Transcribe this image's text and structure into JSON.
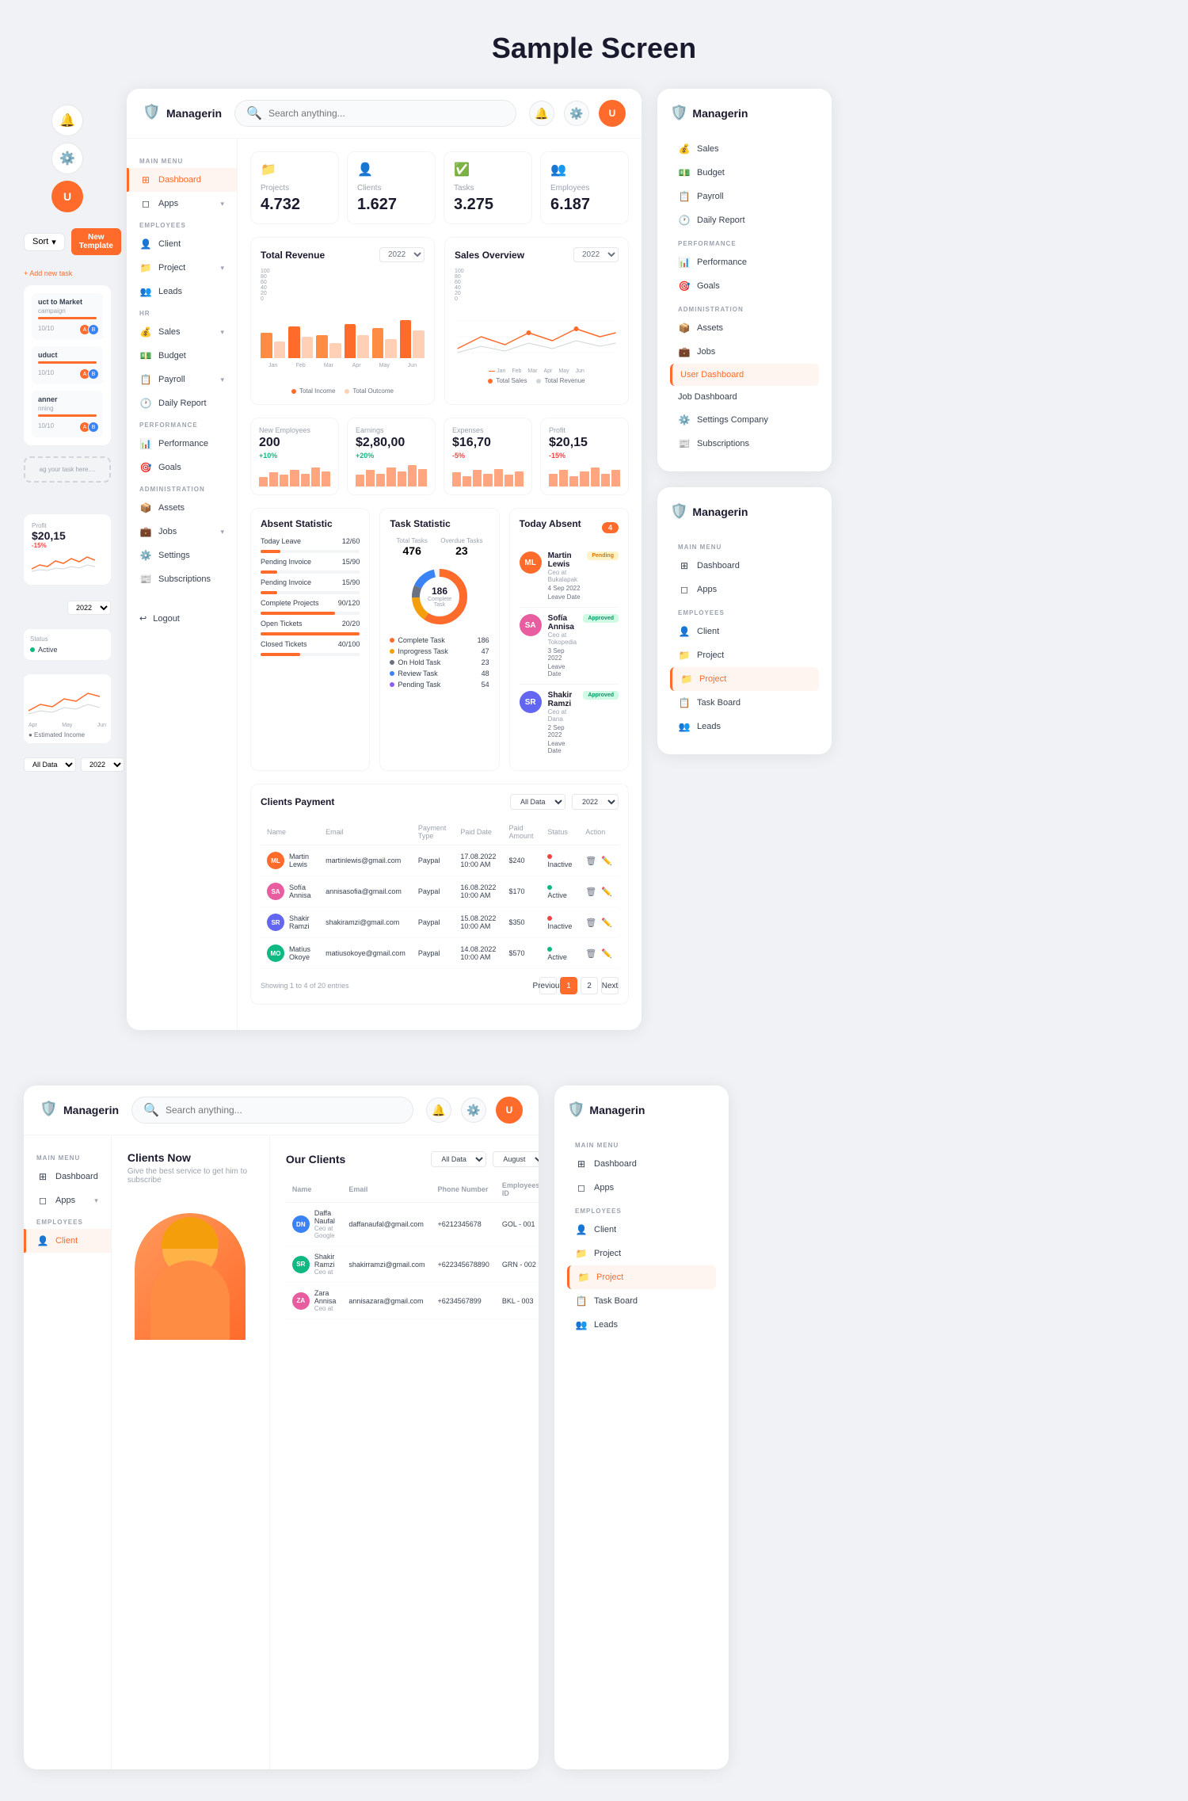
{
  "page": {
    "title": "Sample Screen"
  },
  "logo": {
    "name": "Managerin",
    "icon": "🛡️"
  },
  "header": {
    "search_placeholder": "Search anything...",
    "notification_icon": "🔔",
    "settings_icon": "⚙️"
  },
  "sidebar": {
    "main_menu_label": "MAIN MENU",
    "items": [
      {
        "id": "dashboard",
        "label": "Dashboard",
        "icon": "⊞",
        "active": true
      },
      {
        "id": "apps",
        "label": "Apps",
        "icon": "◻",
        "has_chevron": true
      }
    ],
    "employees_label": "EMPLOYEES",
    "employee_items": [
      {
        "id": "client",
        "label": "Client",
        "icon": "👤"
      },
      {
        "id": "project",
        "label": "Project",
        "icon": "📁",
        "has_chevron": true
      },
      {
        "id": "leads",
        "label": "Leads",
        "icon": "👥"
      }
    ],
    "hr_label": "HR",
    "hr_items": [
      {
        "id": "sales",
        "label": "Sales",
        "icon": "💰",
        "has_chevron": true
      },
      {
        "id": "budget",
        "label": "Budget",
        "icon": "💵"
      },
      {
        "id": "payroll",
        "label": "Payroll",
        "icon": "📋",
        "has_chevron": true
      },
      {
        "id": "daily_report",
        "label": "Daily Report",
        "icon": "🕐"
      }
    ],
    "performance_label": "PERFORMANCE",
    "performance_items": [
      {
        "id": "performance",
        "label": "Performance",
        "icon": "📊"
      },
      {
        "id": "goals",
        "label": "Goals",
        "icon": "🎯"
      }
    ],
    "administration_label": "ADMINISTRATION",
    "admin_items": [
      {
        "id": "assets",
        "label": "Assets",
        "icon": "📦"
      },
      {
        "id": "jobs",
        "label": "Jobs",
        "icon": "💼",
        "has_chevron": true
      },
      {
        "id": "settings",
        "label": "Settings",
        "icon": "⚙️"
      },
      {
        "id": "subscriptions",
        "label": "Subscriptions",
        "icon": "📰"
      }
    ],
    "logout_label": "Logout",
    "logout_icon": "↩"
  },
  "stat_cards": [
    {
      "id": "projects",
      "label": "Projects",
      "value": "4.732",
      "icon": "📁",
      "color": "#ff6b2b"
    },
    {
      "id": "clients",
      "label": "Clients",
      "value": "1.627",
      "icon": "👤",
      "color": "#ff6b2b"
    },
    {
      "id": "tasks",
      "label": "Tasks",
      "value": "3.275",
      "icon": "✅",
      "color": "#ff6b2b"
    },
    {
      "id": "employees",
      "label": "Employees",
      "value": "6.187",
      "icon": "👥",
      "color": "#ff6b2b"
    }
  ],
  "total_revenue": {
    "title": "Total Revenue",
    "year": "2022",
    "legend": [
      "Total Income",
      "Total Outcome"
    ],
    "months": [
      "Jan",
      "Feb",
      "Mar",
      "Apr",
      "May",
      "Jun"
    ],
    "bars": [
      {
        "income": 60,
        "outcome": 40
      },
      {
        "income": 75,
        "outcome": 50
      },
      {
        "income": 55,
        "outcome": 35
      },
      {
        "income": 80,
        "outcome": 55
      },
      {
        "income": 70,
        "outcome": 45
      },
      {
        "income": 90,
        "outcome": 65
      }
    ]
  },
  "sales_overview": {
    "title": "Sales Overview",
    "year": "2022",
    "legend": [
      "Total Sales",
      "Total Revenue"
    ],
    "months": [
      "Jan",
      "Feb",
      "Mar",
      "Apr",
      "May",
      "Jun"
    ]
  },
  "metrics": [
    {
      "id": "new_employees",
      "label": "New Employees",
      "value": "200",
      "change": "+10%",
      "positive": true
    },
    {
      "id": "earnings",
      "label": "Earnings",
      "value": "$2,80,00",
      "change": "+20%",
      "positive": true
    },
    {
      "id": "expenses",
      "label": "Expenses",
      "value": "$16,70",
      "change": "-5%",
      "positive": false
    },
    {
      "id": "profit",
      "label": "Profit",
      "value": "$20,15",
      "change": "-15%",
      "positive": false
    }
  ],
  "absent_statistic": {
    "title": "Absent Statistic",
    "rows": [
      {
        "label": "Today Leave",
        "value": "12/60",
        "percent": 20
      },
      {
        "label": "Pending Invoice",
        "value": "15/90",
        "percent": 17
      },
      {
        "label": "Pending Invoice",
        "value": "15/90",
        "percent": 17
      },
      {
        "label": "Complete Projects",
        "value": "90/120",
        "percent": 75
      },
      {
        "label": "Open Tickets",
        "value": "20/20",
        "percent": 100
      },
      {
        "label": "Closed Tickets",
        "value": "40/100",
        "percent": 40
      }
    ]
  },
  "task_statistic": {
    "title": "Task Statistic",
    "total_tasks_label": "Total Tasks",
    "total_tasks_value": "476",
    "overdue_label": "Overdue Tasks",
    "overdue_value": "23",
    "complete_label": "Complete Task",
    "complete_value": "186 Task",
    "task_items": [
      {
        "label": "Complete Task",
        "value": 186,
        "color": "#ff6b2b"
      },
      {
        "label": "Inprogress Task",
        "value": 47,
        "color": "#f59e0b"
      },
      {
        "label": "On Hold Task",
        "value": 23,
        "color": "#6b7280"
      },
      {
        "label": "Review Task",
        "value": 48,
        "color": "#3b82f6"
      },
      {
        "label": "Pending Task",
        "value": 54,
        "color": "#8b5cf6"
      }
    ]
  },
  "today_absent": {
    "title": "Today Absent",
    "count": "4",
    "people": [
      {
        "name": "Martin Lewis",
        "company": "Ceo at Bukalapak",
        "date": "4 Sep 2022",
        "date_label": "Leave Date",
        "status": "Pending",
        "status_type": "pending",
        "initials": "ML"
      },
      {
        "name": "Sofía Annisa",
        "company": "Ceo at Tokopedia",
        "date": "3 Sep 2022",
        "date_label": "Leave Date",
        "status": "Approved",
        "status_type": "approved",
        "initials": "SA"
      },
      {
        "name": "Shakir Ramzi",
        "company": "Ceo at Dana",
        "date": "2 Sep 2022",
        "date_label": "Leave Date",
        "status": "Approved",
        "status_type": "approved",
        "initials": "SR"
      }
    ]
  },
  "clients_payment": {
    "title": "Clients Payment",
    "filter_all": "All Data",
    "filter_year": "2022",
    "columns": [
      "Name",
      "Email",
      "Payment Type",
      "Paid Date",
      "Paid Amount",
      "Status",
      "Action"
    ],
    "rows": [
      {
        "name": "Martin Lewis",
        "email": "martinlewis@gmail.com",
        "payment_type": "Paypal",
        "paid_date": "17.08.2022\n10:00 AM",
        "paid_amount": "$240",
        "status": "Inactive",
        "status_type": "inactive",
        "initials": "ML"
      },
      {
        "name": "Sofía Annisa",
        "email": "annisasofia@gmail.com",
        "payment_type": "Paypal",
        "paid_date": "16.08.2022\n10:00 AM",
        "paid_amount": "$170",
        "status": "Active",
        "status_type": "active",
        "initials": "SA"
      },
      {
        "name": "Shakir Ramzi",
        "email": "shakiramzi@gmail.com",
        "payment_type": "Paypal",
        "paid_date": "15.08.2022\n10:00 AM",
        "paid_amount": "$350",
        "status": "Inactive",
        "status_type": "inactive",
        "initials": "SR"
      },
      {
        "name": "Matíus Okoye",
        "email": "matiusokoye@gmail.com",
        "payment_type": "Paypal",
        "paid_date": "14.08.2022\n10:00 AM",
        "paid_amount": "$570",
        "status": "Active",
        "status_type": "active",
        "initials": "MO"
      }
    ],
    "showing_text": "Showing 1 to 4 of 20 entries",
    "prev_label": "Previous",
    "next_label": "Next"
  },
  "right_panel_1": {
    "logo_name": "Managerin",
    "nav_items": [
      {
        "id": "sales",
        "label": "Sales",
        "icon": "💰"
      },
      {
        "id": "budget",
        "label": "Budget",
        "icon": "💵"
      },
      {
        "id": "payroll",
        "label": "Payroll",
        "icon": "📋"
      },
      {
        "id": "daily_report",
        "label": "Daily Report",
        "icon": "🕐"
      }
    ],
    "performance_label": "PERFORMANCE",
    "performance_items": [
      {
        "id": "performance",
        "label": "Performance",
        "icon": "📊"
      },
      {
        "id": "goals",
        "label": "Goals",
        "icon": "🎯"
      }
    ],
    "administration_label": "ADMINISTRATION",
    "admin_items": [
      {
        "id": "assets",
        "label": "Assets",
        "icon": "📦"
      },
      {
        "id": "jobs",
        "label": "Jobs",
        "icon": "💼"
      },
      {
        "id": "user_dashboard",
        "label": "User Dashboard",
        "icon": ""
      },
      {
        "id": "job_dashboard",
        "label": "Job Dashboard",
        "icon": ""
      },
      {
        "id": "settings_company",
        "label": "Settings Company",
        "icon": "⚙️"
      },
      {
        "id": "subscriptions",
        "label": "Subscriptions",
        "icon": "📰"
      }
    ]
  },
  "right_panel_2": {
    "logo_name": "Managerin",
    "main_menu_label": "MAIN MENU",
    "nav_items": [
      {
        "id": "dashboard",
        "label": "Dashboard",
        "icon": "⊞"
      },
      {
        "id": "apps",
        "label": "Apps",
        "icon": "◻"
      }
    ],
    "employees_label": "EMPLOYEES",
    "employee_items": [
      {
        "id": "client",
        "label": "Client",
        "icon": "👤"
      },
      {
        "id": "project",
        "label": "Project",
        "icon": "📁"
      },
      {
        "id": "project2",
        "label": "Project",
        "icon": "📁",
        "active": true
      },
      {
        "id": "task_board",
        "label": "Task Board",
        "icon": "📋"
      },
      {
        "id": "leads",
        "label": "Leads",
        "icon": "👥"
      }
    ]
  },
  "second_dashboard": {
    "clients_now": {
      "title": "Clients Now",
      "subtitle": "Give the best service to get him to subscribe"
    },
    "our_clients": {
      "title": "Our Clients",
      "filter_all": "All Data",
      "filter_month": "August",
      "columns": [
        "Name",
        "Email",
        "Phone Number",
        "Employees ID"
      ],
      "rows": [
        {
          "name": "Daffa Naufal",
          "company": "Ceo at Google",
          "email": "daffanaufal@gmail.com",
          "phone": "+6212345678",
          "emp_id": "GOL - 001",
          "initials": "DN"
        },
        {
          "name": "Shakir Ramzi",
          "company": "Ceo at",
          "email": "shakirramzi@gmail.com",
          "phone": "+622345678890",
          "emp_id": "GRN - 002",
          "initials": "SR"
        },
        {
          "name": "Zara Annisa",
          "company": "Ceo at",
          "email": "annisazara@gmail.com",
          "phone": "+6234567899",
          "emp_id": "BKL - 003",
          "initials": "ZA"
        }
      ]
    }
  },
  "profit_widget": {
    "label": "Profit",
    "value": "$20,15",
    "change": "-15%",
    "year": "2022"
  },
  "left_panel": {
    "sort_label": "Sort",
    "new_template_label": "New Template",
    "add_task_label": "+ Add new task",
    "tasks": [
      {
        "title": "uct to Market",
        "sub": "mpaign",
        "progress": "10/10",
        "percent": 100
      },
      {
        "title": "uduct",
        "sub": "",
        "progress": "10/10",
        "percent": 100
      },
      {
        "title": "anner",
        "sub": "nning",
        "progress": "10/10",
        "percent": 100
      }
    ],
    "drag_text": "ag your task here...."
  }
}
